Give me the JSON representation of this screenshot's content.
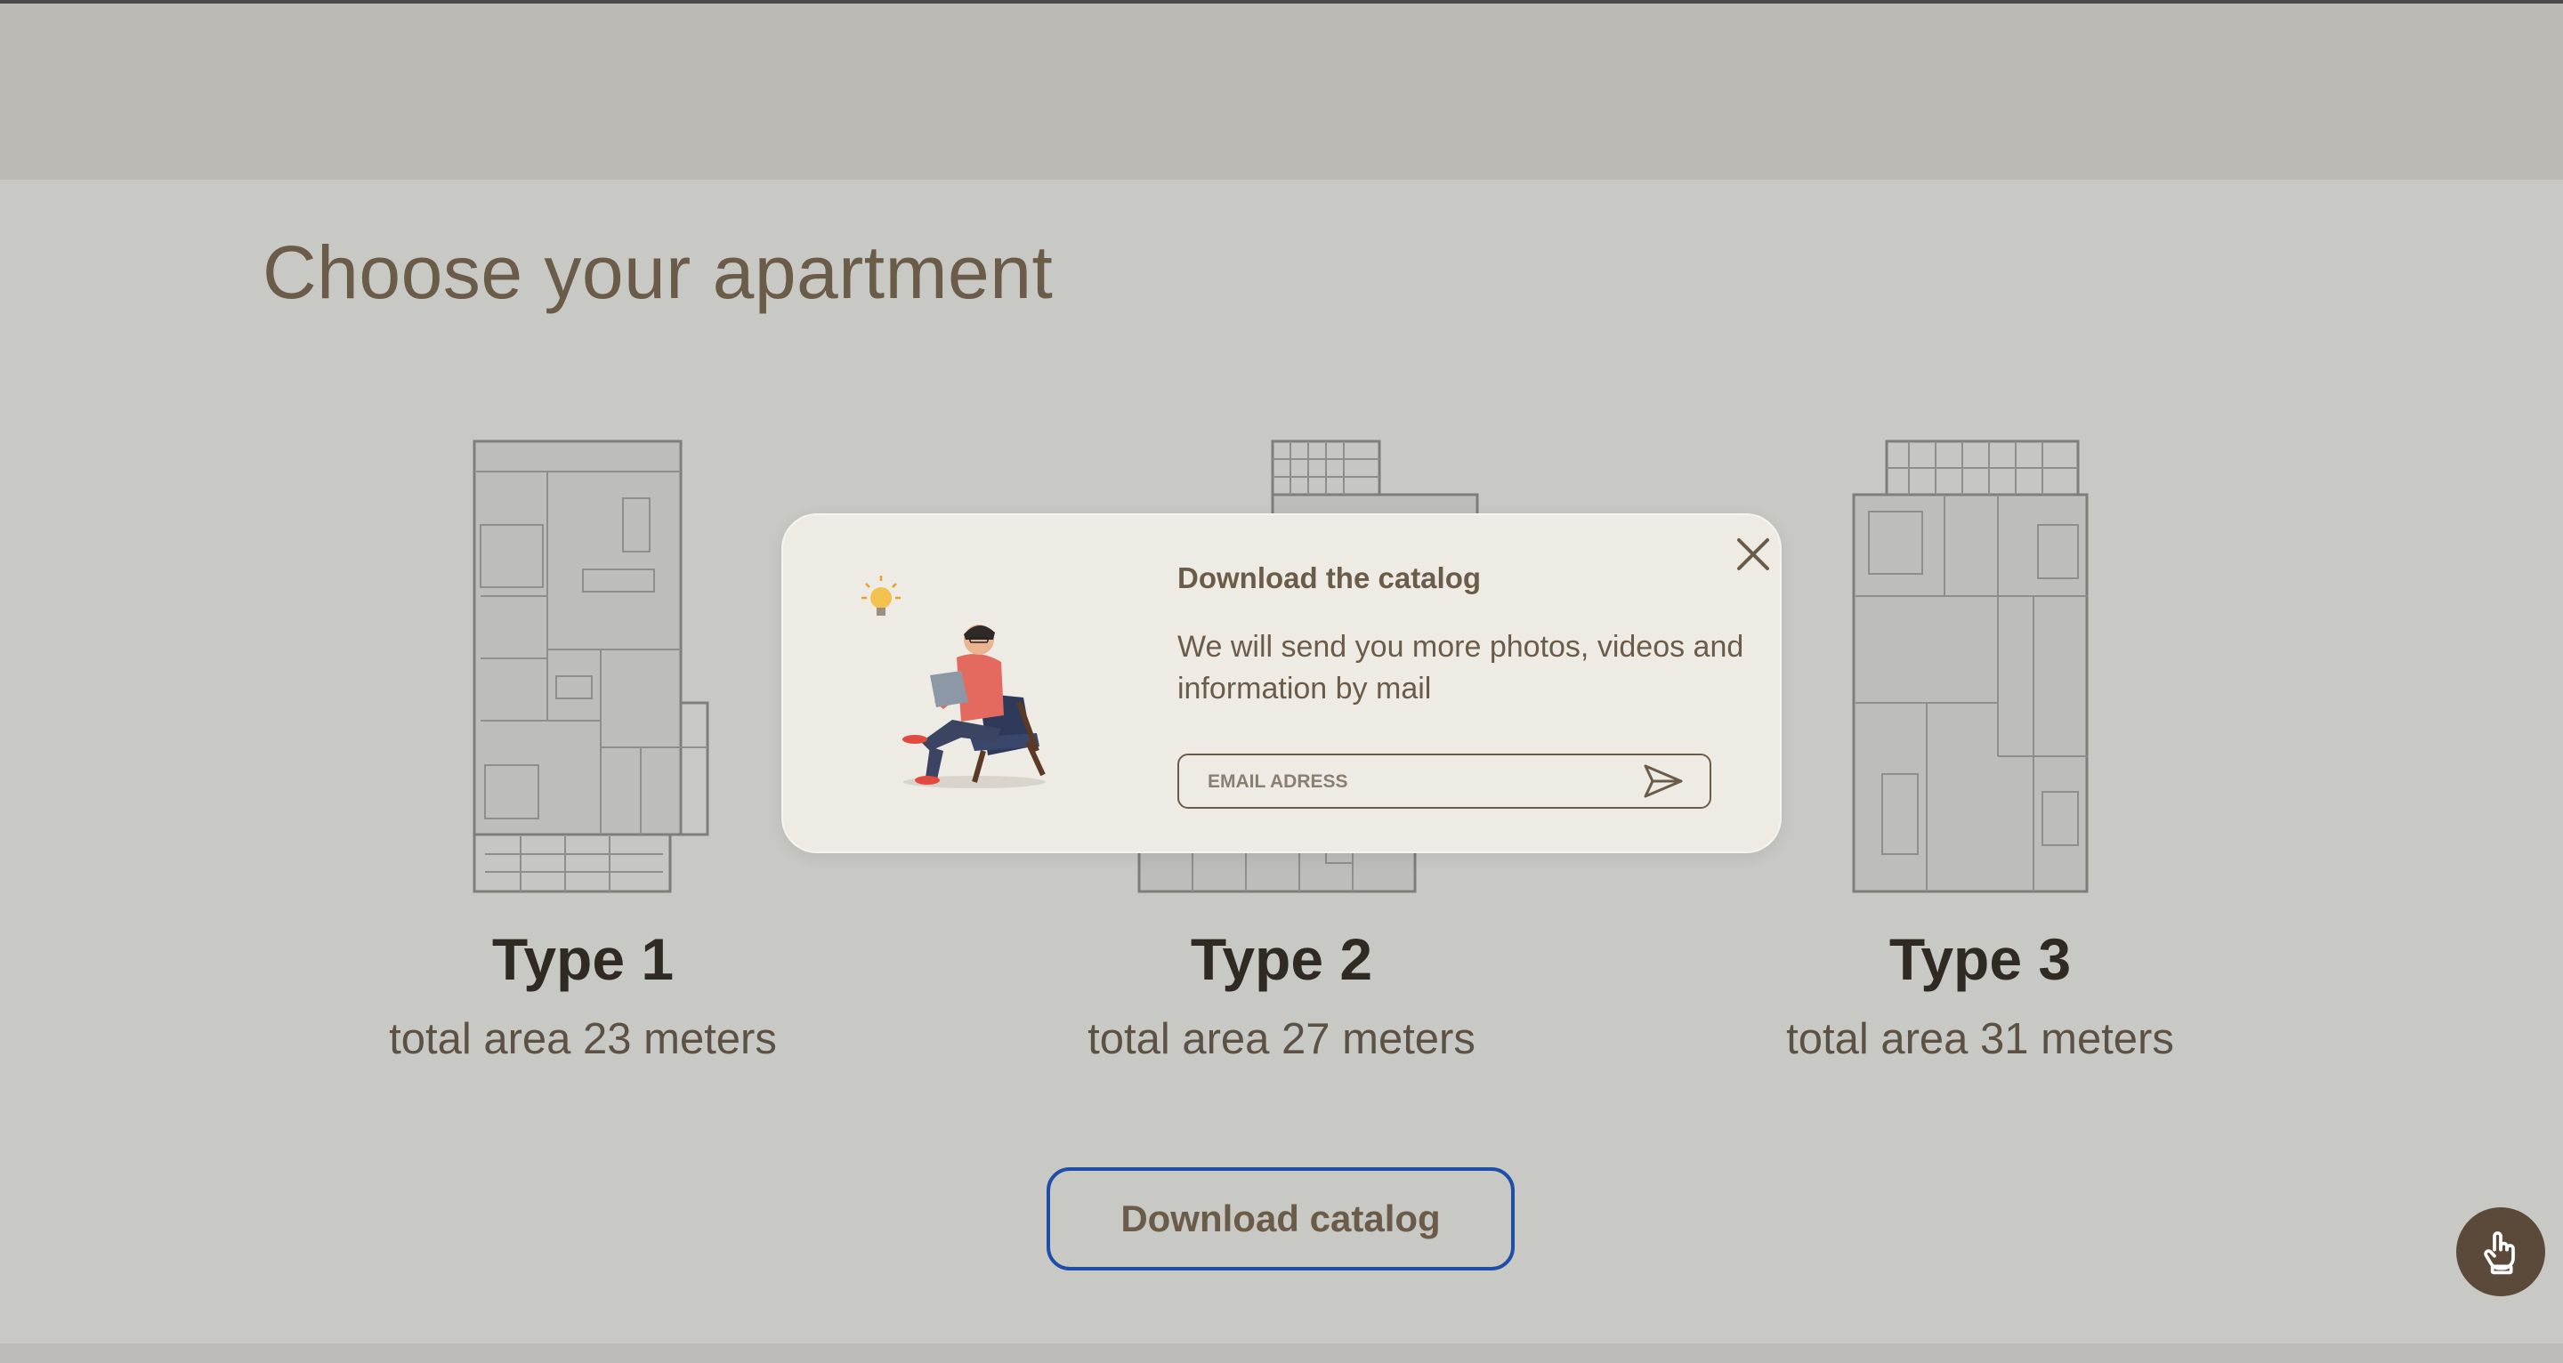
{
  "page": {
    "title": "Choose your apartment"
  },
  "apartments": [
    {
      "type": "Type 1",
      "area": "total area 23 meters"
    },
    {
      "type": "Type 2",
      "area": "total area 27 meters"
    },
    {
      "type": "Type 3",
      "area": "total area 31 meters"
    }
  ],
  "cta": {
    "download_label": "Download catalog"
  },
  "modal": {
    "title": "Download the catalog",
    "text": "We will send you more photos, videos and information by mail",
    "email_placeholder": "EMAIL ADRESS"
  },
  "icons": {
    "close": "close-icon",
    "send": "send-icon",
    "fab": "hand-pointer-icon"
  },
  "colors": {
    "accent": "#6b5c49",
    "button_border": "#1f4ea8",
    "page_bg": "#c8c8c5",
    "header_bg": "#bcbab5",
    "modal_bg": "#eeebe4",
    "fab_bg": "#5b4a3a"
  }
}
